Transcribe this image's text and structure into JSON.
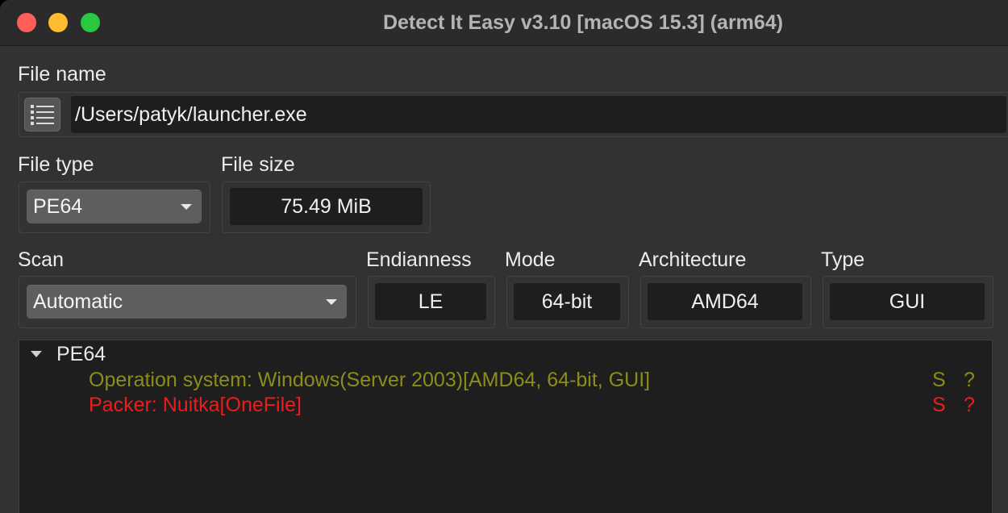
{
  "window": {
    "title": "Detect It Easy v3.10 [macOS 15.3] (arm64)"
  },
  "file_name": {
    "label": "File name",
    "value": "/Users/patyk/launcher.exe"
  },
  "file_type": {
    "label": "File type",
    "selected": "PE64"
  },
  "file_size": {
    "label": "File size",
    "value": "75.49 MiB"
  },
  "scan": {
    "label": "Scan",
    "selected": "Automatic"
  },
  "endianness": {
    "label": "Endianness",
    "value": "LE"
  },
  "mode": {
    "label": "Mode",
    "value": "64-bit"
  },
  "architecture": {
    "label": "Architecture",
    "value": "AMD64"
  },
  "type": {
    "label": "Type",
    "value": "GUI"
  },
  "results": {
    "root": "PE64",
    "rows": [
      {
        "text": "Operation system: Windows(Server 2003)[AMD64, 64-bit, GUI]",
        "s": "S",
        "q": "?",
        "color": "#8c8c1c"
      },
      {
        "text": "Packer: Nuitka[OneFile]",
        "s": "S",
        "q": "?",
        "color": "#ee1c1c"
      }
    ]
  },
  "icons": {
    "list_button": "list-icon",
    "dropdown": "chevron-down-icon",
    "tree_expand": "triangle-down-icon"
  }
}
